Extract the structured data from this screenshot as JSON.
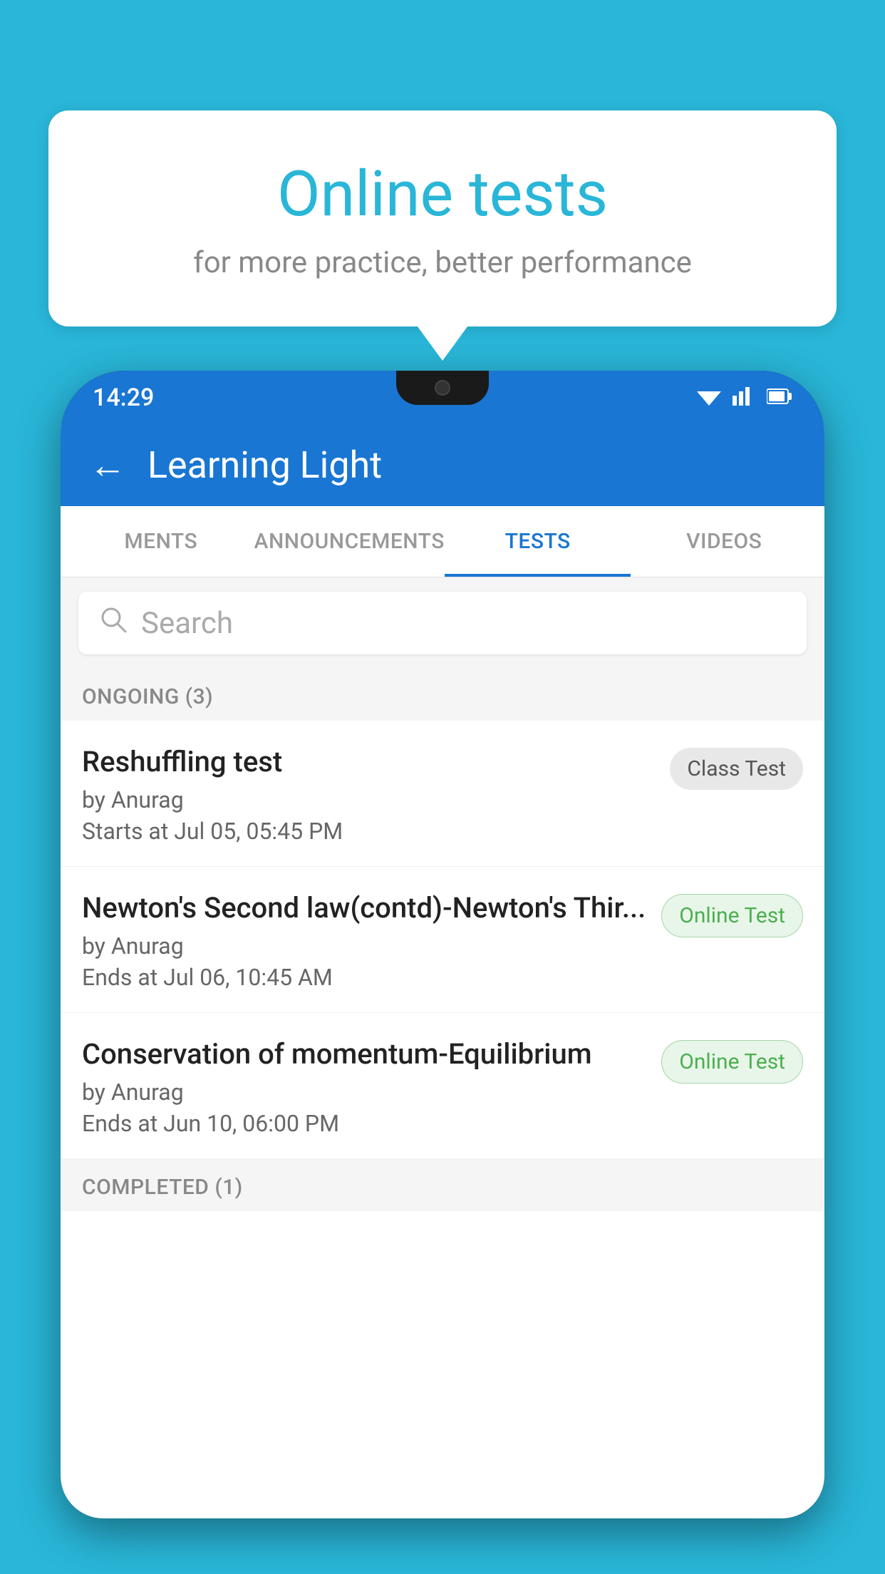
{
  "background_color": "#29b6d8",
  "speech_bubble": {
    "title": "Online tests",
    "subtitle": "for more practice, better performance"
  },
  "app": {
    "status_bar": {
      "time": "14:29",
      "wifi_icon": "▾",
      "signal_icon": "▲",
      "battery_icon": "▮"
    },
    "header": {
      "back_label": "←",
      "title": "Learning Light"
    },
    "tabs": [
      {
        "label": "MENTS",
        "active": false
      },
      {
        "label": "ANNOUNCEMENTS",
        "active": false
      },
      {
        "label": "TESTS",
        "active": true
      },
      {
        "label": "VIDEOS",
        "active": false
      }
    ],
    "search": {
      "placeholder": "Search",
      "icon": "🔍"
    },
    "sections": [
      {
        "title": "ONGOING (3)",
        "tests": [
          {
            "name": "Reshuffling test",
            "author": "by Anurag",
            "time": "Starts at  Jul 05, 05:45 PM",
            "badge": "Class Test",
            "badge_type": "class"
          },
          {
            "name": "Newton's Second law(contd)-Newton's Thir...",
            "author": "by Anurag",
            "time": "Ends at  Jul 06, 10:45 AM",
            "badge": "Online Test",
            "badge_type": "online"
          },
          {
            "name": "Conservation of momentum-Equilibrium",
            "author": "by Anurag",
            "time": "Ends at  Jun 10, 06:00 PM",
            "badge": "Online Test",
            "badge_type": "online"
          }
        ]
      },
      {
        "title": "COMPLETED (1)",
        "tests": []
      }
    ]
  }
}
